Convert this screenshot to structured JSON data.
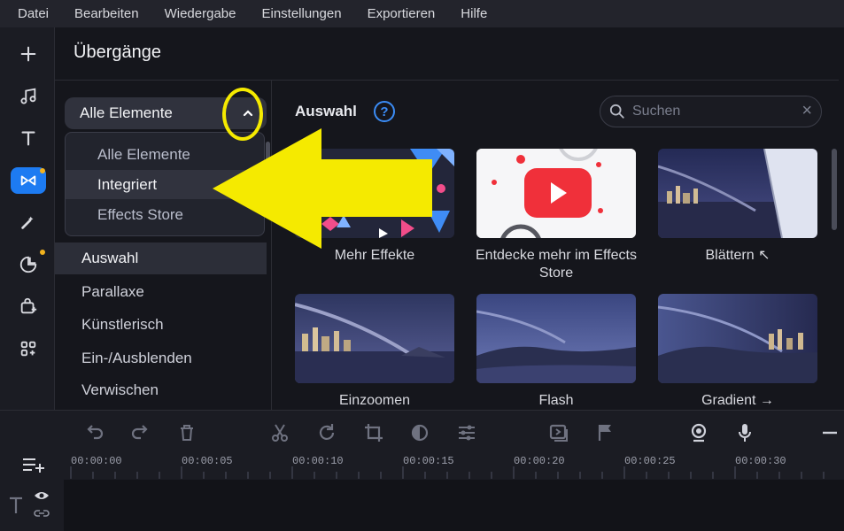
{
  "menu": [
    "Datei",
    "Bearbeiten",
    "Wiedergabe",
    "Einstellungen",
    "Exportieren",
    "Hilfe"
  ],
  "panel_title": "Übergänge",
  "filter": {
    "selected": "Alle Elemente",
    "options": [
      "Alle Elemente",
      "Integriert",
      "Effects Store"
    ],
    "hovered": "Integriert"
  },
  "categories": [
    "Auswahl",
    "Parallaxe",
    "Künstlerisch",
    "Ein-/Ausblenden",
    "Verwischen"
  ],
  "selected_category": "Auswahl",
  "content": {
    "section_label": "Auswahl",
    "help_glyph": "?",
    "search_placeholder": "Suchen",
    "tiles": [
      {
        "label": "Mehr Effekte"
      },
      {
        "label": "Entdecke mehr im Effects Store"
      },
      {
        "label": "Blättern ↖"
      },
      {
        "label": "Einzoomen"
      },
      {
        "label": "Flash"
      },
      {
        "label": "Gradient →"
      }
    ]
  },
  "timeline": {
    "ticks": [
      "00:00:00",
      "00:00:05",
      "00:00:10",
      "00:00:15",
      "00:00:20",
      "00:00:25",
      "00:00:30"
    ]
  },
  "colors": {
    "accent": "#1d7bf2",
    "annotation": "#f5ea00",
    "notification_dot": "#f2b21e"
  },
  "icons": {
    "rail": [
      "plus-icon",
      "music-icon",
      "text-icon",
      "transitions-icon",
      "magic-wand-icon",
      "stickers-icon",
      "store-bag-icon",
      "more-apps-icon"
    ],
    "toolbar": [
      "undo-icon",
      "redo-icon",
      "trash-icon",
      "cut-icon",
      "rotate-icon",
      "crop-icon",
      "color-icon",
      "adjust-icon",
      "fit-icon",
      "flag-icon",
      "webcam-icon",
      "microphone-icon",
      "zoom-out-icon"
    ]
  }
}
